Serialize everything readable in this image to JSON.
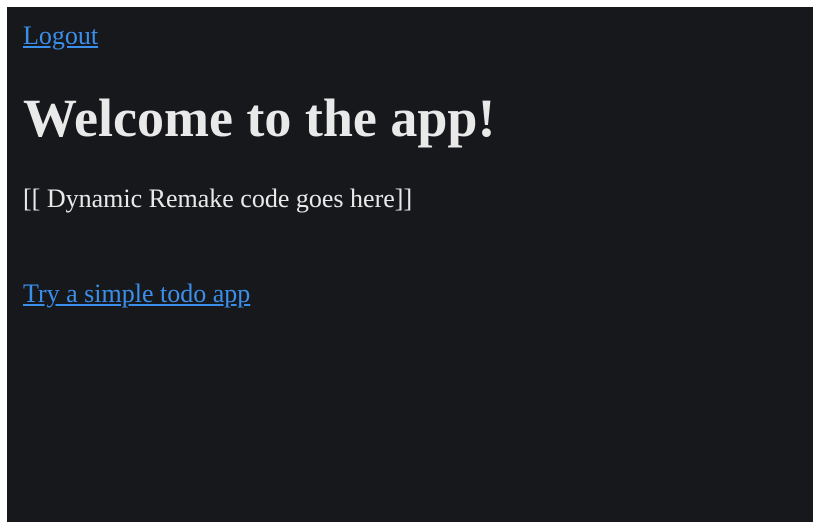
{
  "nav": {
    "logout_label": "Logout"
  },
  "main": {
    "title": "Welcome to the app!",
    "placeholder": "[[ Dynamic Remake code goes here]]",
    "todo_link_label": "Try a simple todo app"
  },
  "colors": {
    "background": "#17181b",
    "text": "#e9e9e9",
    "link": "#3b8eea"
  }
}
